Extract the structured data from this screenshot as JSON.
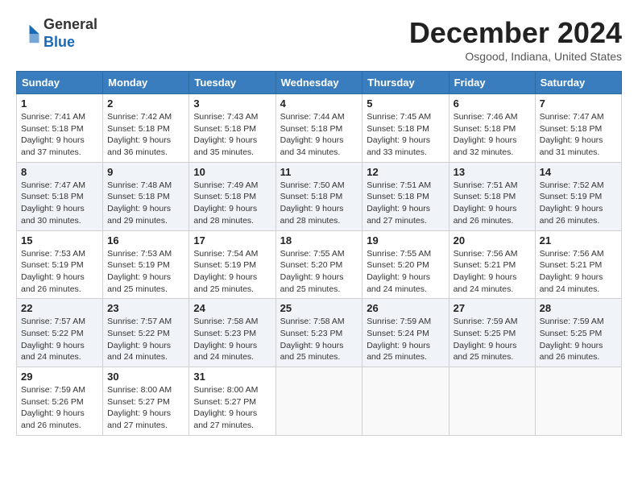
{
  "header": {
    "logo_line1": "General",
    "logo_line2": "Blue",
    "month": "December 2024",
    "location": "Osgood, Indiana, United States"
  },
  "weekdays": [
    "Sunday",
    "Monday",
    "Tuesday",
    "Wednesday",
    "Thursday",
    "Friday",
    "Saturday"
  ],
  "weeks": [
    [
      {
        "day": 1,
        "sunrise": "7:41 AM",
        "sunset": "5:18 PM",
        "daylight": "9 hours and 37 minutes."
      },
      {
        "day": 2,
        "sunrise": "7:42 AM",
        "sunset": "5:18 PM",
        "daylight": "9 hours and 36 minutes."
      },
      {
        "day": 3,
        "sunrise": "7:43 AM",
        "sunset": "5:18 PM",
        "daylight": "9 hours and 35 minutes."
      },
      {
        "day": 4,
        "sunrise": "7:44 AM",
        "sunset": "5:18 PM",
        "daylight": "9 hours and 34 minutes."
      },
      {
        "day": 5,
        "sunrise": "7:45 AM",
        "sunset": "5:18 PM",
        "daylight": "9 hours and 33 minutes."
      },
      {
        "day": 6,
        "sunrise": "7:46 AM",
        "sunset": "5:18 PM",
        "daylight": "9 hours and 32 minutes."
      },
      {
        "day": 7,
        "sunrise": "7:47 AM",
        "sunset": "5:18 PM",
        "daylight": "9 hours and 31 minutes."
      }
    ],
    [
      {
        "day": 8,
        "sunrise": "7:47 AM",
        "sunset": "5:18 PM",
        "daylight": "9 hours and 30 minutes."
      },
      {
        "day": 9,
        "sunrise": "7:48 AM",
        "sunset": "5:18 PM",
        "daylight": "9 hours and 29 minutes."
      },
      {
        "day": 10,
        "sunrise": "7:49 AM",
        "sunset": "5:18 PM",
        "daylight": "9 hours and 28 minutes."
      },
      {
        "day": 11,
        "sunrise": "7:50 AM",
        "sunset": "5:18 PM",
        "daylight": "9 hours and 28 minutes."
      },
      {
        "day": 12,
        "sunrise": "7:51 AM",
        "sunset": "5:18 PM",
        "daylight": "9 hours and 27 minutes."
      },
      {
        "day": 13,
        "sunrise": "7:51 AM",
        "sunset": "5:18 PM",
        "daylight": "9 hours and 26 minutes."
      },
      {
        "day": 14,
        "sunrise": "7:52 AM",
        "sunset": "5:19 PM",
        "daylight": "9 hours and 26 minutes."
      }
    ],
    [
      {
        "day": 15,
        "sunrise": "7:53 AM",
        "sunset": "5:19 PM",
        "daylight": "9 hours and 26 minutes."
      },
      {
        "day": 16,
        "sunrise": "7:53 AM",
        "sunset": "5:19 PM",
        "daylight": "9 hours and 25 minutes."
      },
      {
        "day": 17,
        "sunrise": "7:54 AM",
        "sunset": "5:19 PM",
        "daylight": "9 hours and 25 minutes."
      },
      {
        "day": 18,
        "sunrise": "7:55 AM",
        "sunset": "5:20 PM",
        "daylight": "9 hours and 25 minutes."
      },
      {
        "day": 19,
        "sunrise": "7:55 AM",
        "sunset": "5:20 PM",
        "daylight": "9 hours and 24 minutes."
      },
      {
        "day": 20,
        "sunrise": "7:56 AM",
        "sunset": "5:21 PM",
        "daylight": "9 hours and 24 minutes."
      },
      {
        "day": 21,
        "sunrise": "7:56 AM",
        "sunset": "5:21 PM",
        "daylight": "9 hours and 24 minutes."
      }
    ],
    [
      {
        "day": 22,
        "sunrise": "7:57 AM",
        "sunset": "5:22 PM",
        "daylight": "9 hours and 24 minutes."
      },
      {
        "day": 23,
        "sunrise": "7:57 AM",
        "sunset": "5:22 PM",
        "daylight": "9 hours and 24 minutes."
      },
      {
        "day": 24,
        "sunrise": "7:58 AM",
        "sunset": "5:23 PM",
        "daylight": "9 hours and 24 minutes."
      },
      {
        "day": 25,
        "sunrise": "7:58 AM",
        "sunset": "5:23 PM",
        "daylight": "9 hours and 25 minutes."
      },
      {
        "day": 26,
        "sunrise": "7:59 AM",
        "sunset": "5:24 PM",
        "daylight": "9 hours and 25 minutes."
      },
      {
        "day": 27,
        "sunrise": "7:59 AM",
        "sunset": "5:25 PM",
        "daylight": "9 hours and 25 minutes."
      },
      {
        "day": 28,
        "sunrise": "7:59 AM",
        "sunset": "5:25 PM",
        "daylight": "9 hours and 26 minutes."
      }
    ],
    [
      {
        "day": 29,
        "sunrise": "7:59 AM",
        "sunset": "5:26 PM",
        "daylight": "9 hours and 26 minutes."
      },
      {
        "day": 30,
        "sunrise": "8:00 AM",
        "sunset": "5:27 PM",
        "daylight": "9 hours and 27 minutes."
      },
      {
        "day": 31,
        "sunrise": "8:00 AM",
        "sunset": "5:27 PM",
        "daylight": "9 hours and 27 minutes."
      },
      null,
      null,
      null,
      null
    ]
  ]
}
